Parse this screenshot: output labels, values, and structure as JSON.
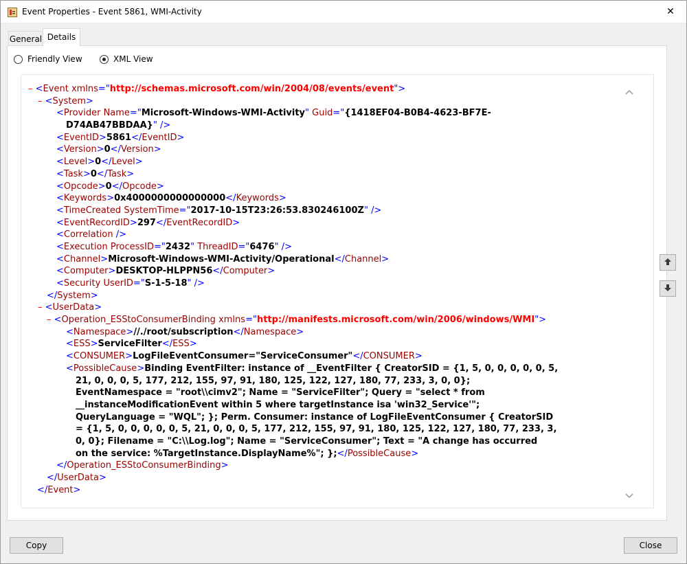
{
  "window": {
    "title": "Event Properties - Event 5861, WMI-Activity",
    "close_glyph": "✕"
  },
  "tabs": [
    {
      "label": "General"
    },
    {
      "label": "Details"
    }
  ],
  "view_options": {
    "friendly": {
      "label": "Friendly View",
      "selected": false
    },
    "xml": {
      "label": "XML View",
      "selected": true
    }
  },
  "xml": {
    "collapse_glyph": "–",
    "event_tag": "Event",
    "xmlns_attr": "xmlns",
    "event_ns": "http://schemas.microsoft.com/win/2004/08/events/event",
    "system_tag": "System",
    "provider_tag": "Provider",
    "provider_name_attr": "Name",
    "provider_name": "Microsoft-Windows-WMI-Activity",
    "provider_guid_attr": "Guid",
    "provider_guid_line1": "{1418EF04-B0B4-4623-BF7E-",
    "provider_guid_line2": "D74AB47BBDAA}",
    "eventid_tag": "EventID",
    "eventid": "5861",
    "version_tag": "Version",
    "version": "0",
    "level_tag": "Level",
    "level": "0",
    "task_tag": "Task",
    "task": "0",
    "opcode_tag": "Opcode",
    "opcode": "0",
    "keywords_tag": "Keywords",
    "keywords": "0x4000000000000000",
    "timecreated_tag": "TimeCreated",
    "systemtime_attr": "SystemTime",
    "systemtime": "2017-10-15T23:26:53.830246100Z",
    "eventrecordid_tag": "EventRecordID",
    "eventrecordid": "297",
    "correlation_tag": "Correlation",
    "execution_tag": "Execution",
    "processid_attr": "ProcessID",
    "processid": "2432",
    "threadid_attr": "ThreadID",
    "threadid": "6476",
    "channel_tag": "Channel",
    "channel": "Microsoft-Windows-WMI-Activity/Operational",
    "computer_tag": "Computer",
    "computer": "DESKTOP-HLPPN56",
    "security_tag": "Security",
    "userid_attr": "UserID",
    "userid": "S-1-5-18",
    "userdata_tag": "UserData",
    "binding_tag": "Operation_ESStoConsumerBinding",
    "binding_ns": "http://manifests.microsoft.com/win/2006/windows/WMI",
    "namespace_tag": "Namespace",
    "namespace": "//./root/subscription",
    "ess_tag": "ESS",
    "ess": "ServiceFilter",
    "consumer_tag": "CONSUMER",
    "consumer": "LogFileEventConsumer=\"ServiceConsumer\"",
    "possiblecause_tag": "PossibleCause",
    "possiblecause_lines": [
      "Binding EventFilter: instance of __EventFilter { CreatorSID = {1, 5, 0, 0, 0, 0, 0, 5,",
      "21, 0, 0, 0, 5, 177, 212, 155, 97, 91, 180, 125, 122, 127, 180, 77, 233, 3, 0, 0};",
      "EventNamespace = \"root\\\\cimv2\"; Name = \"ServiceFilter\"; Query = \"select * from",
      "__instanceModificationEvent within 5 where targetInstance isa 'win32_Service'\";",
      "QueryLanguage = \"WQL\"; }; Perm. Consumer: instance of LogFileEventConsumer { CreatorSID",
      "= {1, 5, 0, 0, 0, 0, 0, 5, 21, 0, 0, 0, 5, 177, 212, 155, 97, 91, 180, 125, 122, 127, 180, 77, 233, 3,",
      "0, 0}; Filename = \"C:\\\\Log.log\"; Name = \"ServiceConsumer\"; Text = \"A change has occurred",
      "on the service: %TargetInstance.DisplayName%\"; };"
    ]
  },
  "buttons": {
    "copy": "Copy",
    "close": "Close"
  },
  "colors": {
    "tag": "#990000",
    "bracket": "#0000ff",
    "namespace": "#ff0000",
    "collapse": "#ff0000"
  },
  "icons": {
    "app": "event-viewer-icon",
    "up": "arrow-up-icon",
    "down": "arrow-down-icon",
    "scroll_up": "chevron-up-icon",
    "scroll_down": "chevron-down-icon"
  }
}
